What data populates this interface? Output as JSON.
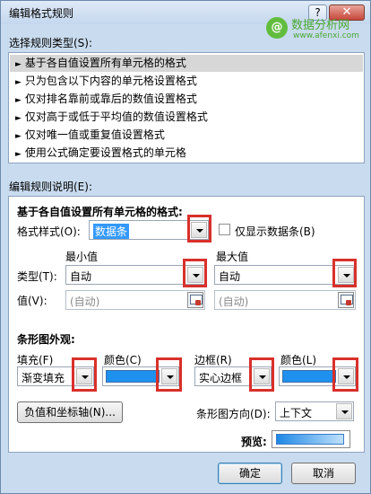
{
  "window": {
    "title": "编辑格式规则",
    "help": "?",
    "close": "✕"
  },
  "watermark": {
    "logo": "@",
    "name": "数据分析网",
    "url": "www.afenxi.com"
  },
  "rule_type": {
    "label": "选择规则类型(S):",
    "arrow": "►",
    "items": [
      "基于各自值设置所有单元格的格式",
      "只为包含以下内容的单元格设置格式",
      "仅对排名靠前或靠后的数值设置格式",
      "仅对高于或低于平均值的数值设置格式",
      "仅对唯一值或重复值设置格式",
      "使用公式确定要设置格式的单元格"
    ],
    "selected_index": 0
  },
  "rule_desc": {
    "label": "编辑规则说明(E):",
    "heading": "基于各自值设置所有单元格的格式:",
    "format_style_label": "格式样式(O):",
    "format_style_value": "数据条",
    "show_bar_only_label": "仅显示数据条(B)",
    "show_bar_only_checked": false,
    "min_header": "最小值",
    "max_header": "最大值",
    "type_label": "类型(T):",
    "min_type": "自动",
    "max_type": "自动",
    "value_label": "值(V):",
    "min_value": "(自动)",
    "max_value": "(自动)",
    "bar_appearance_heading": "条形图外观:",
    "fill_label": "填充(F)",
    "fill_value": "渐变填充",
    "fill_color_label": "颜色(C)",
    "border_label": "边框(R)",
    "border_value": "实心边框",
    "border_color_label": "颜色(L)",
    "bar_color": "#1e90ee",
    "neg_axis_button": "负值和坐标轴(N)...",
    "direction_label": "条形图方向(D):",
    "direction_value": "上下文",
    "preview_label": "预览:"
  },
  "footer": {
    "ok": "确定",
    "cancel": "取消"
  }
}
